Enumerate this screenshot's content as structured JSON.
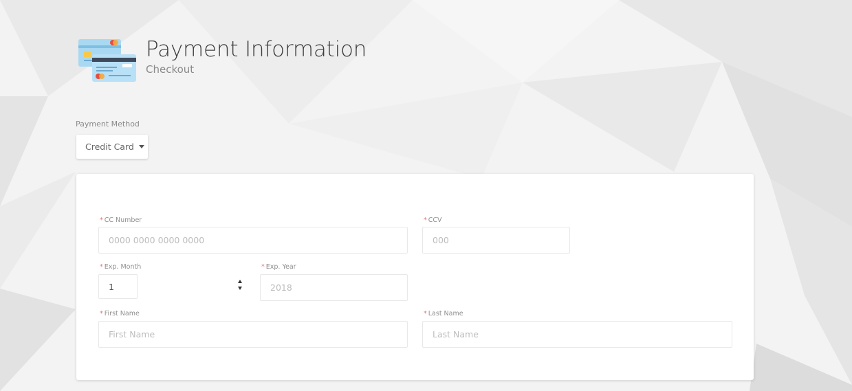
{
  "header": {
    "title": "Payment Information",
    "subtitle": "Checkout",
    "icon": "credit-cards-icon"
  },
  "payment_method": {
    "label": "Payment Method",
    "selected": "Credit Card"
  },
  "form": {
    "required_marker": "*",
    "cc_number": {
      "label": "CC Number",
      "value": "",
      "placeholder": "0000 0000 0000 0000"
    },
    "ccv": {
      "label": "CCV",
      "value": "",
      "placeholder": "000"
    },
    "exp_month": {
      "label": "Exp. Month",
      "value": "1"
    },
    "exp_year": {
      "label": "Exp. Year",
      "value": "",
      "placeholder": "2018"
    },
    "first_name": {
      "label": "First Name",
      "value": "",
      "placeholder": "First Name"
    },
    "last_name": {
      "label": "Last Name",
      "value": "",
      "placeholder": "Last Name"
    }
  },
  "colors": {
    "background": "#efefef",
    "card": "#ffffff",
    "required_marker": "#e57373",
    "icon_card_blue": "#9fd3ef",
    "icon_chip_yellow": "#f7c948",
    "icon_logo_red": "#e74c3c"
  }
}
